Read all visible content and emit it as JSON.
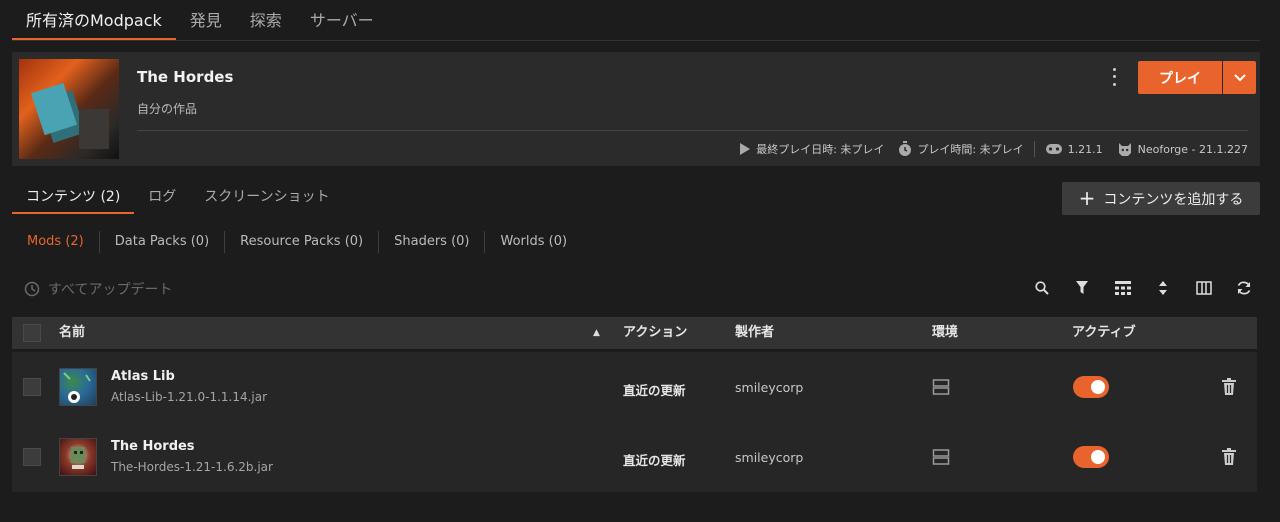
{
  "top_tabs": [
    {
      "label": "所有済のModpack"
    },
    {
      "label": "発見"
    },
    {
      "label": "探索"
    },
    {
      "label": "サーバー"
    }
  ],
  "pack": {
    "title": "The Hordes",
    "subtitle": "自分の作品",
    "last_played": "最終プレイ日時: 未プレイ",
    "play_time": "プレイ時間: 未プレイ",
    "mc_version": "1.21.1",
    "loader": "Neoforge - 21.1.227",
    "play_label": "プレイ"
  },
  "content_tabs": [
    {
      "label": "コンテンツ (2)"
    },
    {
      "label": "ログ"
    },
    {
      "label": "スクリーンショット"
    }
  ],
  "add_content_label": "コンテンツを追加する",
  "filters": [
    {
      "label": "Mods (2)"
    },
    {
      "label": "Data Packs (0)"
    },
    {
      "label": "Resource Packs (0)"
    },
    {
      "label": "Shaders (0)"
    },
    {
      "label": "Worlds (0)"
    }
  ],
  "update_all_label": "すべてアップデート",
  "columns": {
    "name": "名前",
    "action": "アクション",
    "author": "製作者",
    "environment": "環境",
    "active": "アクティブ"
  },
  "mods": [
    {
      "name": "Atlas Lib",
      "file": "Atlas-Lib-1.21.0-1.1.14.jar",
      "action": "直近の更新",
      "author": "smileycorp",
      "active": true,
      "icon": "atlas-lib-icon"
    },
    {
      "name": "The Hordes",
      "file": "The-Hordes-1.21-1.6.2b.jar",
      "action": "直近の更新",
      "author": "smileycorp",
      "active": true,
      "icon": "hordes-icon"
    }
  ],
  "colors": {
    "accent": "#e8642c",
    "background": "#1c1c1c",
    "panel": "#2b2b2b"
  }
}
